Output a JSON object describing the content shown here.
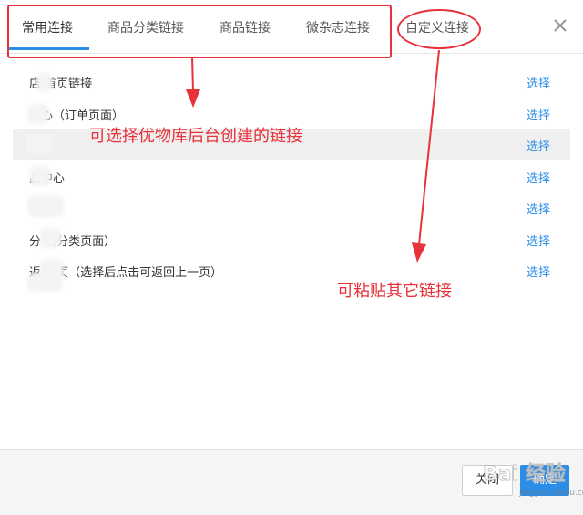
{
  "tabs": [
    {
      "label": "常用连接"
    },
    {
      "label": "商品分类链接"
    },
    {
      "label": "商品链接"
    },
    {
      "label": "微杂志连接"
    },
    {
      "label": "自定义连接"
    }
  ],
  "close_icon": "close-icon",
  "rows": [
    {
      "label": "店   首页链接",
      "action": "选择"
    },
    {
      "label": "     中心（订单页面）",
      "action": "选择"
    },
    {
      "label": "     车",
      "action": "选择"
    },
    {
      "label": "     品中心",
      "action": "选择"
    },
    {
      "label": "     ",
      "action": "选择"
    },
    {
      "label": "分     （分类页面）",
      "action": "选择"
    },
    {
      "label": "返     一页（选择后点击可返回上一页）",
      "action": "选择"
    }
  ],
  "annotations": {
    "text1": "可选择优物库后台创建的链接",
    "text2": "可粘贴其它链接"
  },
  "footer": {
    "close_label": "关闭",
    "ok_label": "确定"
  },
  "watermark": {
    "main": "Bai 经验",
    "sub": "jingyan.baidu.com"
  },
  "colors": {
    "accent": "#2a8ee9",
    "annotation": "#e8313a"
  }
}
